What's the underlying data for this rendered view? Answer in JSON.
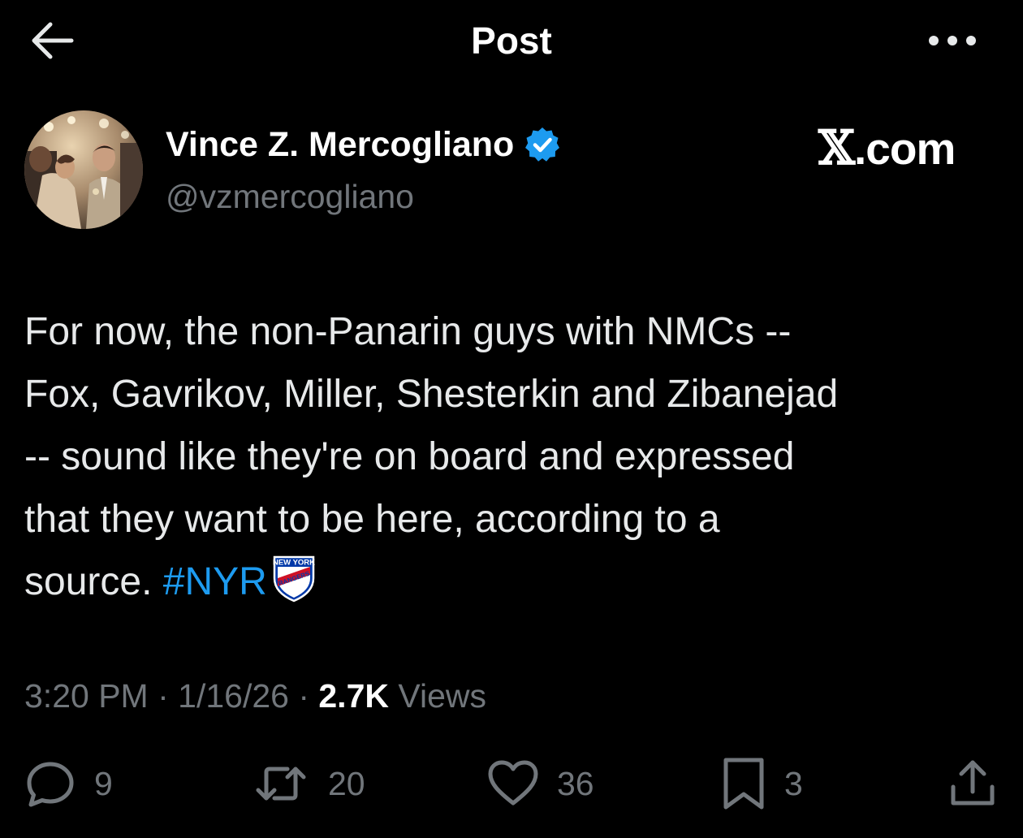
{
  "header": {
    "title": "Post"
  },
  "author": {
    "name": "Vince Z. Mercogliano",
    "handle": "@vzmercogliano",
    "verified": true
  },
  "watermark": {
    "x_glyph": "𝕏",
    "text": ".com"
  },
  "tweet": {
    "lines": [
      "For now, the non-Panarin guys with NMCs --",
      "Fox, Gavrikov, Miller, Shesterkin and Zibanejad",
      "-- sound like they're on board and expressed",
      "that they want to be here, according to a",
      "source. "
    ],
    "hashtag": "#NYR",
    "emoji_text": {
      "top": "NEW YORK",
      "diagonal": "RANGERS"
    }
  },
  "meta": {
    "time": "3:20 PM",
    "sep1": " · ",
    "date": "1/16/26",
    "sep2": " · ",
    "views_count": "2.7K",
    "views_label": " Views"
  },
  "actions": {
    "replies": "9",
    "reposts": "20",
    "likes": "36",
    "bookmarks": "3"
  },
  "colors": {
    "background": "#000000",
    "text": "#e7e9ea",
    "secondary": "#71767b",
    "accent": "#1d9bf0"
  },
  "icons": {
    "back": "arrow-left-icon",
    "more": "more-horizontal-icon",
    "verified": "verified-badge-icon",
    "reply": "reply-icon",
    "repost": "repost-icon",
    "like": "heart-icon",
    "bookmark": "bookmark-icon",
    "share": "share-icon"
  }
}
